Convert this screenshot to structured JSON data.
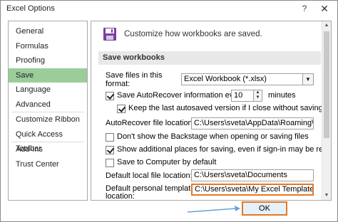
{
  "window": {
    "title": "Excel Options",
    "help": "?",
    "close": "✕"
  },
  "sidebar": {
    "items": [
      {
        "label": "General"
      },
      {
        "label": "Formulas"
      },
      {
        "label": "Proofing"
      },
      {
        "label": "Save",
        "selected": true
      },
      {
        "label": "Language"
      },
      {
        "label": "Advanced"
      },
      {
        "label": "Customize Ribbon"
      },
      {
        "label": "Quick Access Toolbar"
      },
      {
        "label": "Add-Ins"
      },
      {
        "label": "Trust Center"
      }
    ]
  },
  "main": {
    "header": "Customize how workbooks are saved.",
    "section": "Save workbooks",
    "save_format_label_1": "Save files in this",
    "save_format_label_2": "format:",
    "save_format_value": "Excel Workbook (*.xlsx)",
    "autorecover_label": "Save AutoRecover information every",
    "autorecover_value": "10",
    "minutes_label": "minutes",
    "keep_last_label": "Keep the last autosaved version if I close without saving",
    "autorecover_location_label": "AutoRecover file location:",
    "autorecover_location_value": "C:\\Users\\sveta\\AppData\\Roaming\\Micro",
    "backstage_label": "Don't show the Backstage when opening or saving files",
    "additional_places_label": "Show additional places for saving, even if sign-in may be required.",
    "save_to_computer_label": "Save to Computer by default",
    "default_local_label": "Default local file location:",
    "default_local_value": "C:\\Users\\sveta\\Documents",
    "templates_label_1": "Default personal templates",
    "templates_label_2": "location:",
    "templates_value": "C:\\Users\\sveta\\My Excel Templates\\"
  },
  "buttons": {
    "ok": "OK"
  },
  "checkboxes": {
    "autorecover": true,
    "keep_last": true,
    "backstage": false,
    "additional_places": true,
    "save_to_computer": false
  },
  "colors": {
    "highlight": "#e87722",
    "selected": "#9bcd9b",
    "save_icon": "#7b3f9e"
  }
}
